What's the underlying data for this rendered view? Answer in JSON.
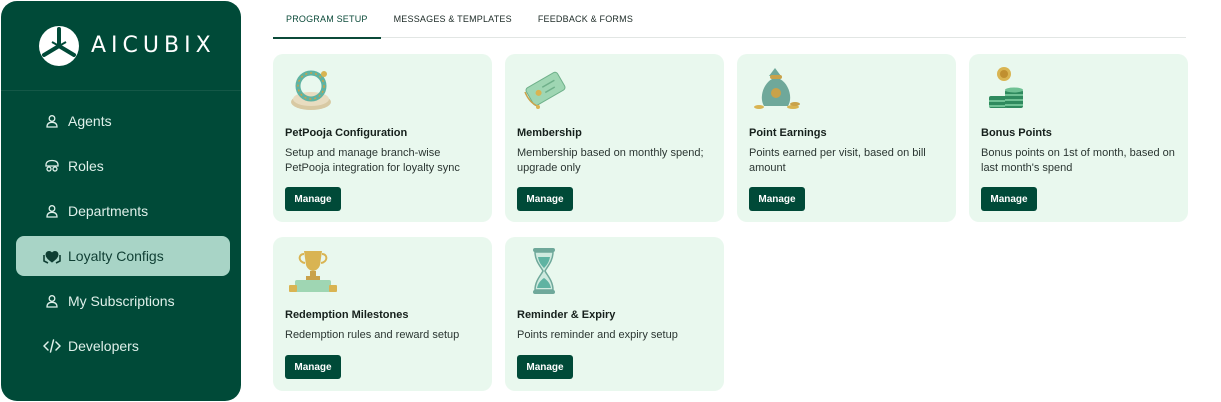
{
  "brand": {
    "name": "AICUBIX"
  },
  "sidebar": {
    "items": [
      {
        "label": "Agents",
        "icon": "user-icon",
        "active": false
      },
      {
        "label": "Roles",
        "icon": "roles-icon",
        "active": false
      },
      {
        "label": "Departments",
        "icon": "user-icon",
        "active": false
      },
      {
        "label": "Loyalty Configs",
        "icon": "loyalty-icon",
        "active": true
      },
      {
        "label": "My Subscriptions",
        "icon": "user-icon",
        "active": false
      },
      {
        "label": "Developers",
        "icon": "code-icon",
        "active": false
      }
    ]
  },
  "tabs": [
    {
      "label": "PROGRAM SETUP",
      "active": true
    },
    {
      "label": "MESSAGES & TEMPLATES",
      "active": false
    },
    {
      "label": "FEEDBACK & FORMS",
      "active": false
    }
  ],
  "cards": [
    {
      "title": "PetPooja Configuration",
      "desc": "Setup and manage branch-wise PetPooja integration for loyalty sync",
      "button": "Manage",
      "icon": "ring-dish-icon"
    },
    {
      "title": "Membership",
      "desc": "Membership based on monthly spend; upgrade only",
      "button": "Manage",
      "icon": "membership-ticket-icon"
    },
    {
      "title": "Point Earnings",
      "desc": "Points earned per visit, based on bill amount",
      "button": "Manage",
      "icon": "money-bag-icon"
    },
    {
      "title": "Bonus Points",
      "desc": "Bonus points on 1st of month, based on last month's spend",
      "button": "Manage",
      "icon": "coin-stack-icon"
    },
    {
      "title": "Redemption Milestones",
      "desc": "Redemption rules and reward setup",
      "button": "Manage",
      "icon": "trophy-icon"
    },
    {
      "title": "Reminder & Expiry",
      "desc": "Points reminder and expiry setup",
      "button": "Manage",
      "icon": "hourglass-icon"
    }
  ],
  "colors": {
    "sidebar_bg": "#004a38",
    "active_item_bg": "#a8d4c6",
    "card_bg": "#e9f8ee",
    "button_bg": "#004a38"
  }
}
